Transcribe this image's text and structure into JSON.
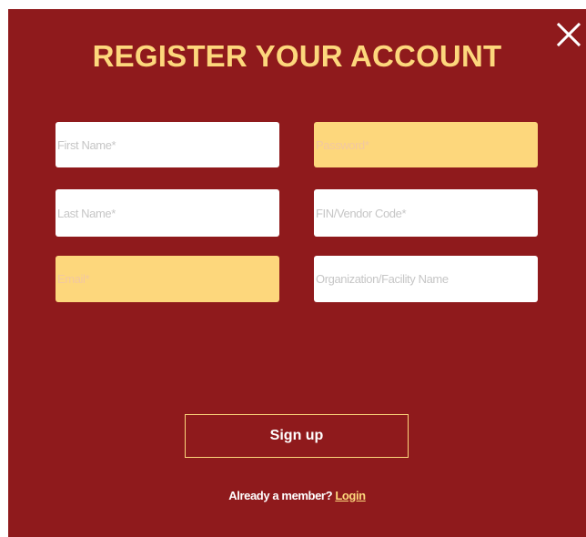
{
  "modal": {
    "title": "REGISTER YOUR ACCOUNT",
    "close_icon": "close-icon",
    "colors": {
      "background": "#8f1a1c",
      "accent": "#fdd77c",
      "field_background": "#ffffff",
      "field_highlight": "#fdd77c",
      "text": "#ffffff"
    }
  },
  "form": {
    "first_name": {
      "placeholder": "First Name*",
      "value": ""
    },
    "password": {
      "placeholder": "Password*",
      "value": ""
    },
    "last_name": {
      "placeholder": "Last Name*",
      "value": ""
    },
    "fin_vendor_code": {
      "placeholder": "FIN/Vendor Code*",
      "value": ""
    },
    "email": {
      "placeholder": "Email*",
      "value": ""
    },
    "organization": {
      "placeholder": "Organization/Facility Name",
      "value": ""
    },
    "signup_label": "Sign up"
  },
  "footer": {
    "prompt": "Already a member?",
    "login_label": "Login"
  }
}
